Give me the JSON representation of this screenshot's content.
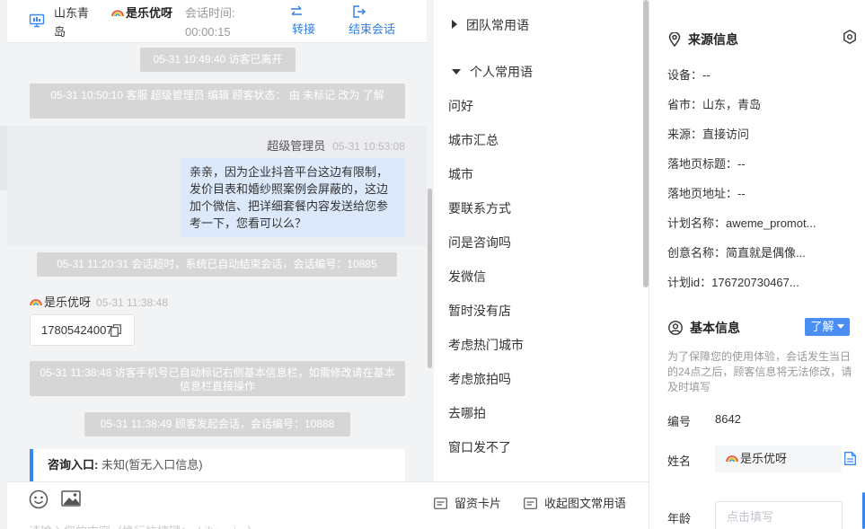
{
  "header": {
    "location": "山东青岛",
    "user_name": "是乐优呀",
    "session_time_label": "会话时间:",
    "session_time": "00:00:15",
    "transfer_label": "转接",
    "end_label": "结束会话"
  },
  "messages": {
    "sys_1": "05-31 10:49:40 访客已离开",
    "sys_2": "05-31 10:50:10 客服 超级管理员 编辑 顾客状态： 由 未标记 改为 了解",
    "agent_name": "超级管理员",
    "agent_time": "05-31 10:53:08",
    "agent_text": "亲亲，因为企业抖音平台这边有限制，发价目表和婚纱照案例会屏蔽的，这边加个微信、把详细套餐内容发送给您参考一下，您看可以么？",
    "sys_3": "05-31 11:20:31 会话超时，系统已自动结束会话，会话编号：10885",
    "visitor_name": "是乐优呀",
    "visitor_time": "05-31 11:38:48",
    "phone": "17805424007",
    "sys_4": "05-31 11:38:48 访客手机号已自动标记右侧基本信息栏，如需修改请在基本信息栏直接操作",
    "sys_5": "05-31 11:38:49 顾客发起会话，会话编号：10888",
    "consult_label": "咨询入口:",
    "consult_value": "未知(暂无入口信息)"
  },
  "input": {
    "placeholder": "请输入您的内容（换行快捷键：shift+enter）"
  },
  "phrases": {
    "team_group": "团队常用语",
    "personal_group": "个人常用语",
    "items": [
      "问好",
      "城市汇总",
      "城市",
      "要联系方式",
      "问是咨询吗",
      "发微信",
      "暂时没有店",
      "考虑热门城市",
      "考虑旅拍吗",
      "去哪拍",
      "窗口发不了"
    ],
    "card_btn": "留资卡片",
    "collapse_btn": "收起图文常用语"
  },
  "source_info": {
    "title": "来源信息",
    "rows": [
      "设备：--",
      "省市：山东，青岛",
      "来源：直接访问",
      "落地页标题：--",
      "落地页地址：--",
      "计划名称：aweme_promot...",
      "创意名称：简直就是偶像...",
      "计划id：176720730467..."
    ]
  },
  "basic_info": {
    "title": "基本信息",
    "learn_label": "了解",
    "hint": "为了保障您的使用体验，会话发生当日的24点之后，顾客信息将无法修改，请及时填写",
    "code_label": "编号",
    "code_value": "8642",
    "name_label": "姓名",
    "name_value": "是乐优呀",
    "age_label": "年龄",
    "age_placeholder": "点击填写"
  },
  "colors": {
    "accent": "#3a86f0",
    "system_bubble": "#d6d6d6",
    "agent_bubble": "#dce9fb",
    "learn_button": "#4b8ef5"
  }
}
